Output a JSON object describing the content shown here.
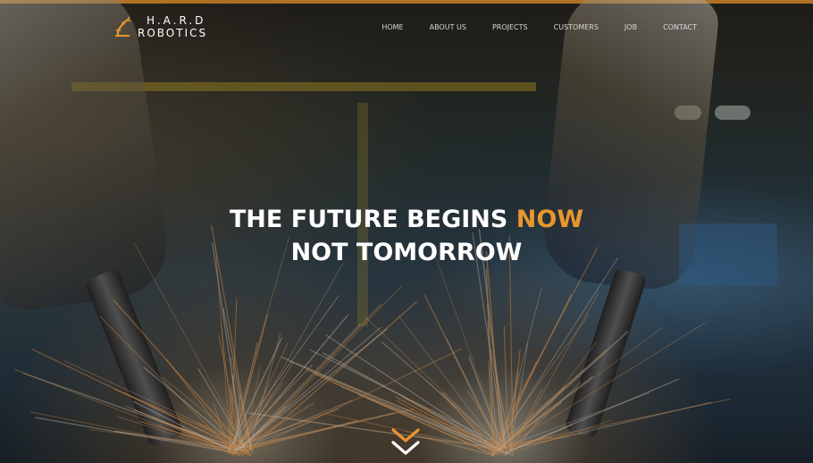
{
  "brand": {
    "line1": "H.A.R.D",
    "line2": "ROBOTICS",
    "icon": "robot-arm-icon",
    "accent_color": "#e8962e"
  },
  "nav": {
    "items": [
      {
        "label": "HOME"
      },
      {
        "label": "ABOUT US"
      },
      {
        "label": "PROJECTS"
      },
      {
        "label": "CUSTOMERS"
      },
      {
        "label": "JOB"
      },
      {
        "label": "CONTACT"
      }
    ]
  },
  "hero": {
    "headline_part1": "THE FUTURE BEGINS ",
    "headline_accent": "NOW",
    "headline_line2": "NOT TOMORROW",
    "scroll_icon": "double-chevron-down-icon"
  }
}
